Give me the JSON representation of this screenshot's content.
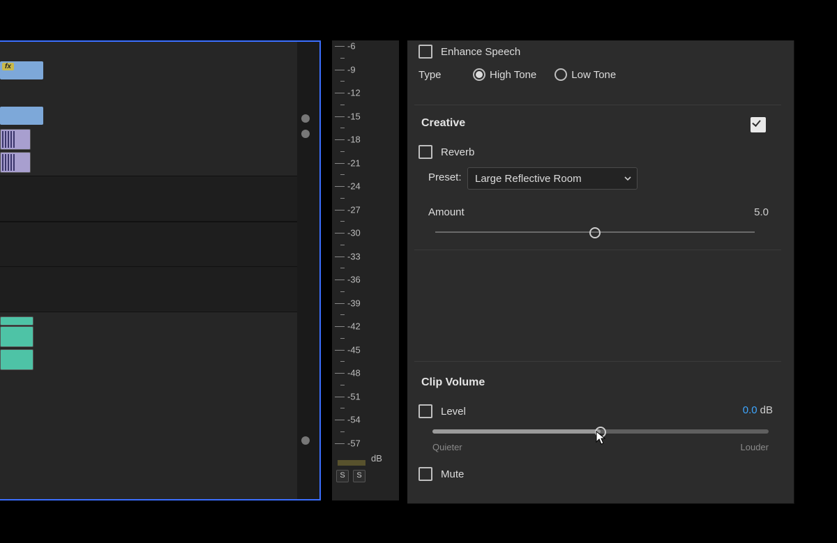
{
  "enhance_speech": {
    "label": "Enhance Speech",
    "checked": false
  },
  "type": {
    "label": "Type",
    "options": {
      "high": "High Tone",
      "low": "Low Tone"
    },
    "selected": "high"
  },
  "creative": {
    "title": "Creative",
    "enabled": true,
    "reverb": {
      "label": "Reverb",
      "checked": false
    },
    "preset": {
      "label": "Preset:",
      "value": "Large Reflective Room"
    },
    "amount": {
      "label": "Amount",
      "value": "5.0",
      "position_pct": 50
    }
  },
  "clip_volume": {
    "title": "Clip Volume",
    "level": {
      "label": "Level",
      "checked": false,
      "value": "0.0",
      "unit": "dB",
      "position_pct": 50
    },
    "hints": {
      "left": "Quieter",
      "right": "Louder"
    },
    "mute": {
      "label": "Mute",
      "checked": false
    }
  },
  "meter": {
    "ticks": [
      "-6",
      "-9",
      "-12",
      "-15",
      "-18",
      "-21",
      "-24",
      "-27",
      "-30",
      "-33",
      "-36",
      "-39",
      "-42",
      "-45",
      "-48",
      "-51",
      "-54",
      "-57"
    ],
    "unit": "dB",
    "solo_buttons": [
      "S",
      "S"
    ]
  },
  "timeline": {
    "fx_badge": "fx"
  }
}
